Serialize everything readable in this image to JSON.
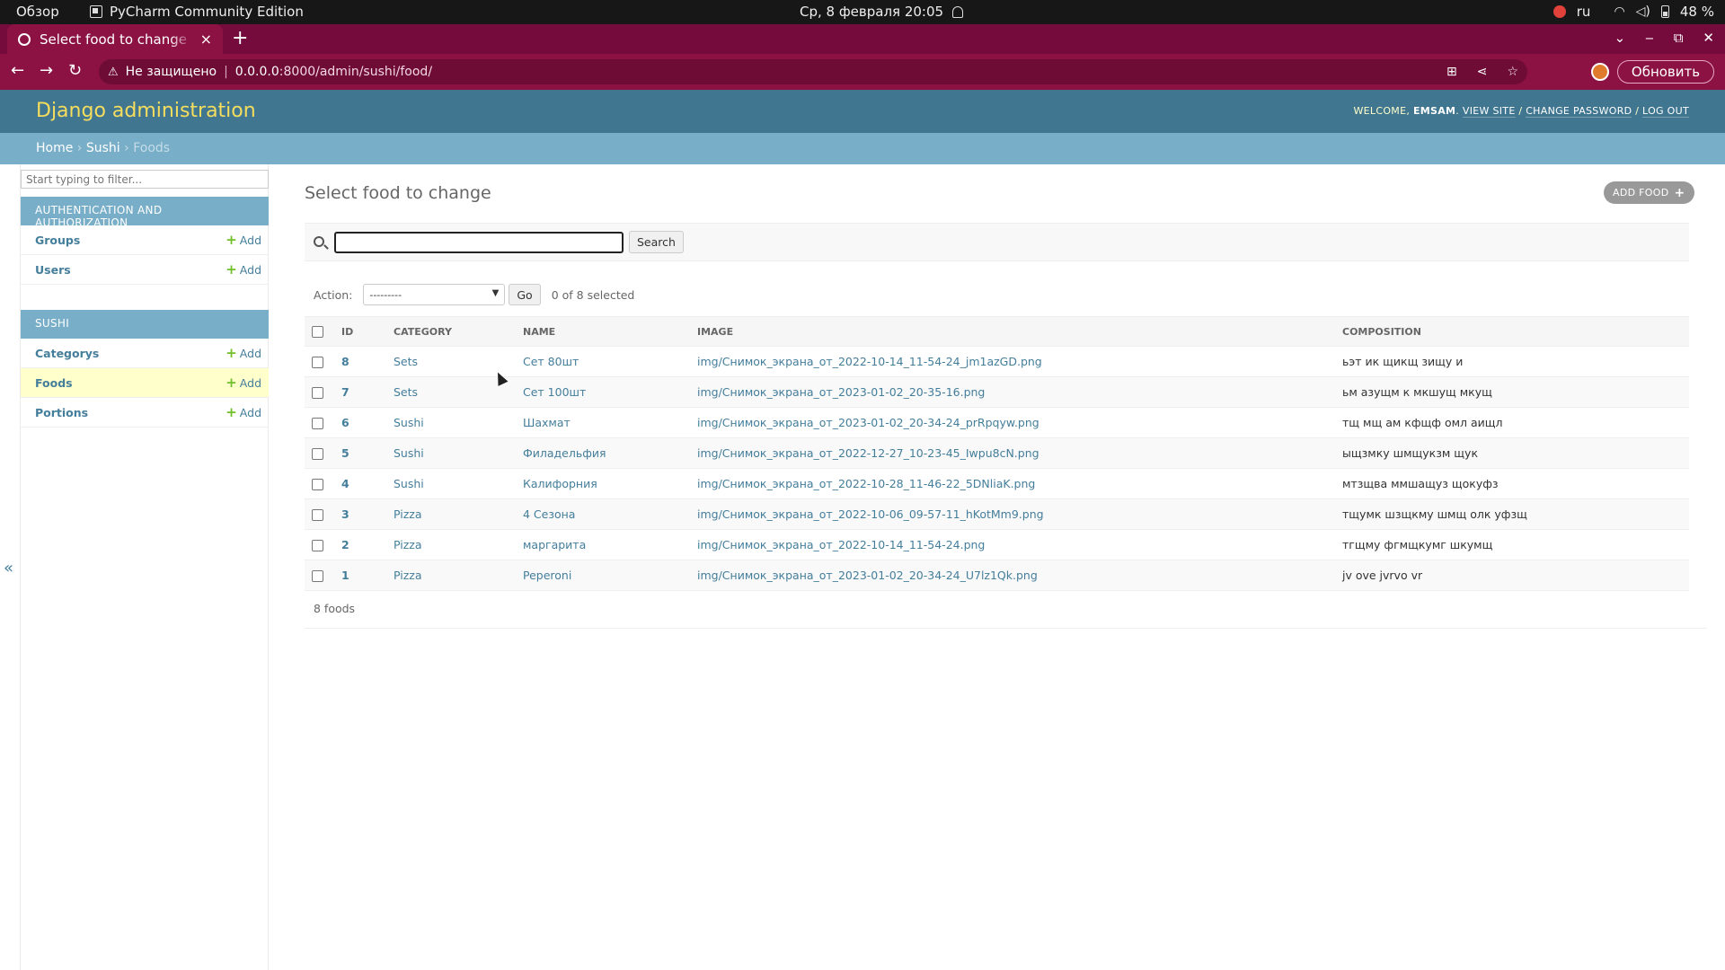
{
  "os": {
    "activities": "Обзор",
    "app_name": "PyCharm Community Edition",
    "clock": "Ср, 8 февраля  20:05",
    "lang": "ru",
    "battery": "48 %"
  },
  "browser": {
    "tab_title": "Select food to change | Django site admin",
    "tab_close": "×",
    "new_tab": "+",
    "not_secure": "Не защищено",
    "url_host": "0.0.0.0",
    "url_rest": ":8000/admin/sushi/food/",
    "update_button": "Обновить"
  },
  "header": {
    "branding": "Django administration",
    "welcome": "WELCOME,",
    "user": "EMSAM",
    "view_site": "VIEW SITE",
    "change_password": "CHANGE PASSWORD",
    "log_out": "LOG OUT",
    "sep": "/"
  },
  "breadcrumbs": {
    "home": "Home",
    "app": "Sushi",
    "current": "Foods",
    "sep": "›"
  },
  "sidebar": {
    "filter_placeholder": "Start typing to filter...",
    "modules": [
      {
        "caption": "AUTHENTICATION AND AUTHORIZATION",
        "models": [
          {
            "name": "Groups",
            "add": "Add"
          },
          {
            "name": "Users",
            "add": "Add"
          }
        ]
      },
      {
        "caption": "SUSHI",
        "models": [
          {
            "name": "Categorys",
            "add": "Add"
          },
          {
            "name": "Foods",
            "add": "Add",
            "current": true
          },
          {
            "name": "Portions",
            "add": "Add"
          }
        ]
      }
    ],
    "collapse": "«"
  },
  "content": {
    "title": "Select food to change",
    "add_button": "ADD FOOD",
    "search_button": "Search",
    "search_value": "",
    "action_label": "Action:",
    "action_selected": "---------",
    "go_button": "Go",
    "action_counter": "0 of 8 selected",
    "columns": [
      "ID",
      "CATEGORY",
      "NAME",
      "IMAGE",
      "COMPOSITION"
    ],
    "rows": [
      {
        "id": "8",
        "category": "Sets",
        "name": "Сет 80шт",
        "image": "img/Снимок_экрана_от_2022-10-14_11-54-24_jm1azGD.png",
        "composition": "ьэт ик щикщ зищу и"
      },
      {
        "id": "7",
        "category": "Sets",
        "name": "Сет 100шт",
        "image": "img/Снимок_экрана_от_2023-01-02_20-35-16.png",
        "composition": "ьм азущм к мкшущ мкущ"
      },
      {
        "id": "6",
        "category": "Sushi",
        "name": "Шахмат",
        "image": "img/Снимок_экрана_от_2023-01-02_20-34-24_prRpqyw.png",
        "composition": "тщ мщ ам кфщф омл аищл"
      },
      {
        "id": "5",
        "category": "Sushi",
        "name": "Филадельфия",
        "image": "img/Снимок_экрана_от_2022-12-27_10-23-45_Iwpu8cN.png",
        "composition": "ыщзмку шмщукзм щук"
      },
      {
        "id": "4",
        "category": "Sushi",
        "name": "Калифорния",
        "image": "img/Снимок_экрана_от_2022-10-28_11-46-22_5DNliaK.png",
        "composition": "мтзщва ммшащуз щокуфз"
      },
      {
        "id": "3",
        "category": "Pizza",
        "name": "4 Сезона",
        "image": "img/Снимок_экрана_от_2022-10-06_09-57-11_hKotMm9.png",
        "composition": "тщумк шзщкму шмщ олк уфзщ"
      },
      {
        "id": "2",
        "category": "Pizza",
        "name": "маргарита",
        "image": "img/Снимок_экрана_от_2022-10-14_11-54-24.png",
        "composition": "тгщму фгмщкумг шкумщ"
      },
      {
        "id": "1",
        "category": "Pizza",
        "name": "Peperoni",
        "image": "img/Снимок_экрана_от_2023-01-02_20-34-24_U7lz1Qk.png",
        "composition": "jv ove jvrvo vr"
      }
    ],
    "paginator": "8 foods"
  },
  "colors": {
    "header_bg": "#417690",
    "branding": "#f5dd5d",
    "breadcrumbs_bg": "#79aec8",
    "link": "#447e9b",
    "browser_bg": "#8c1244"
  }
}
